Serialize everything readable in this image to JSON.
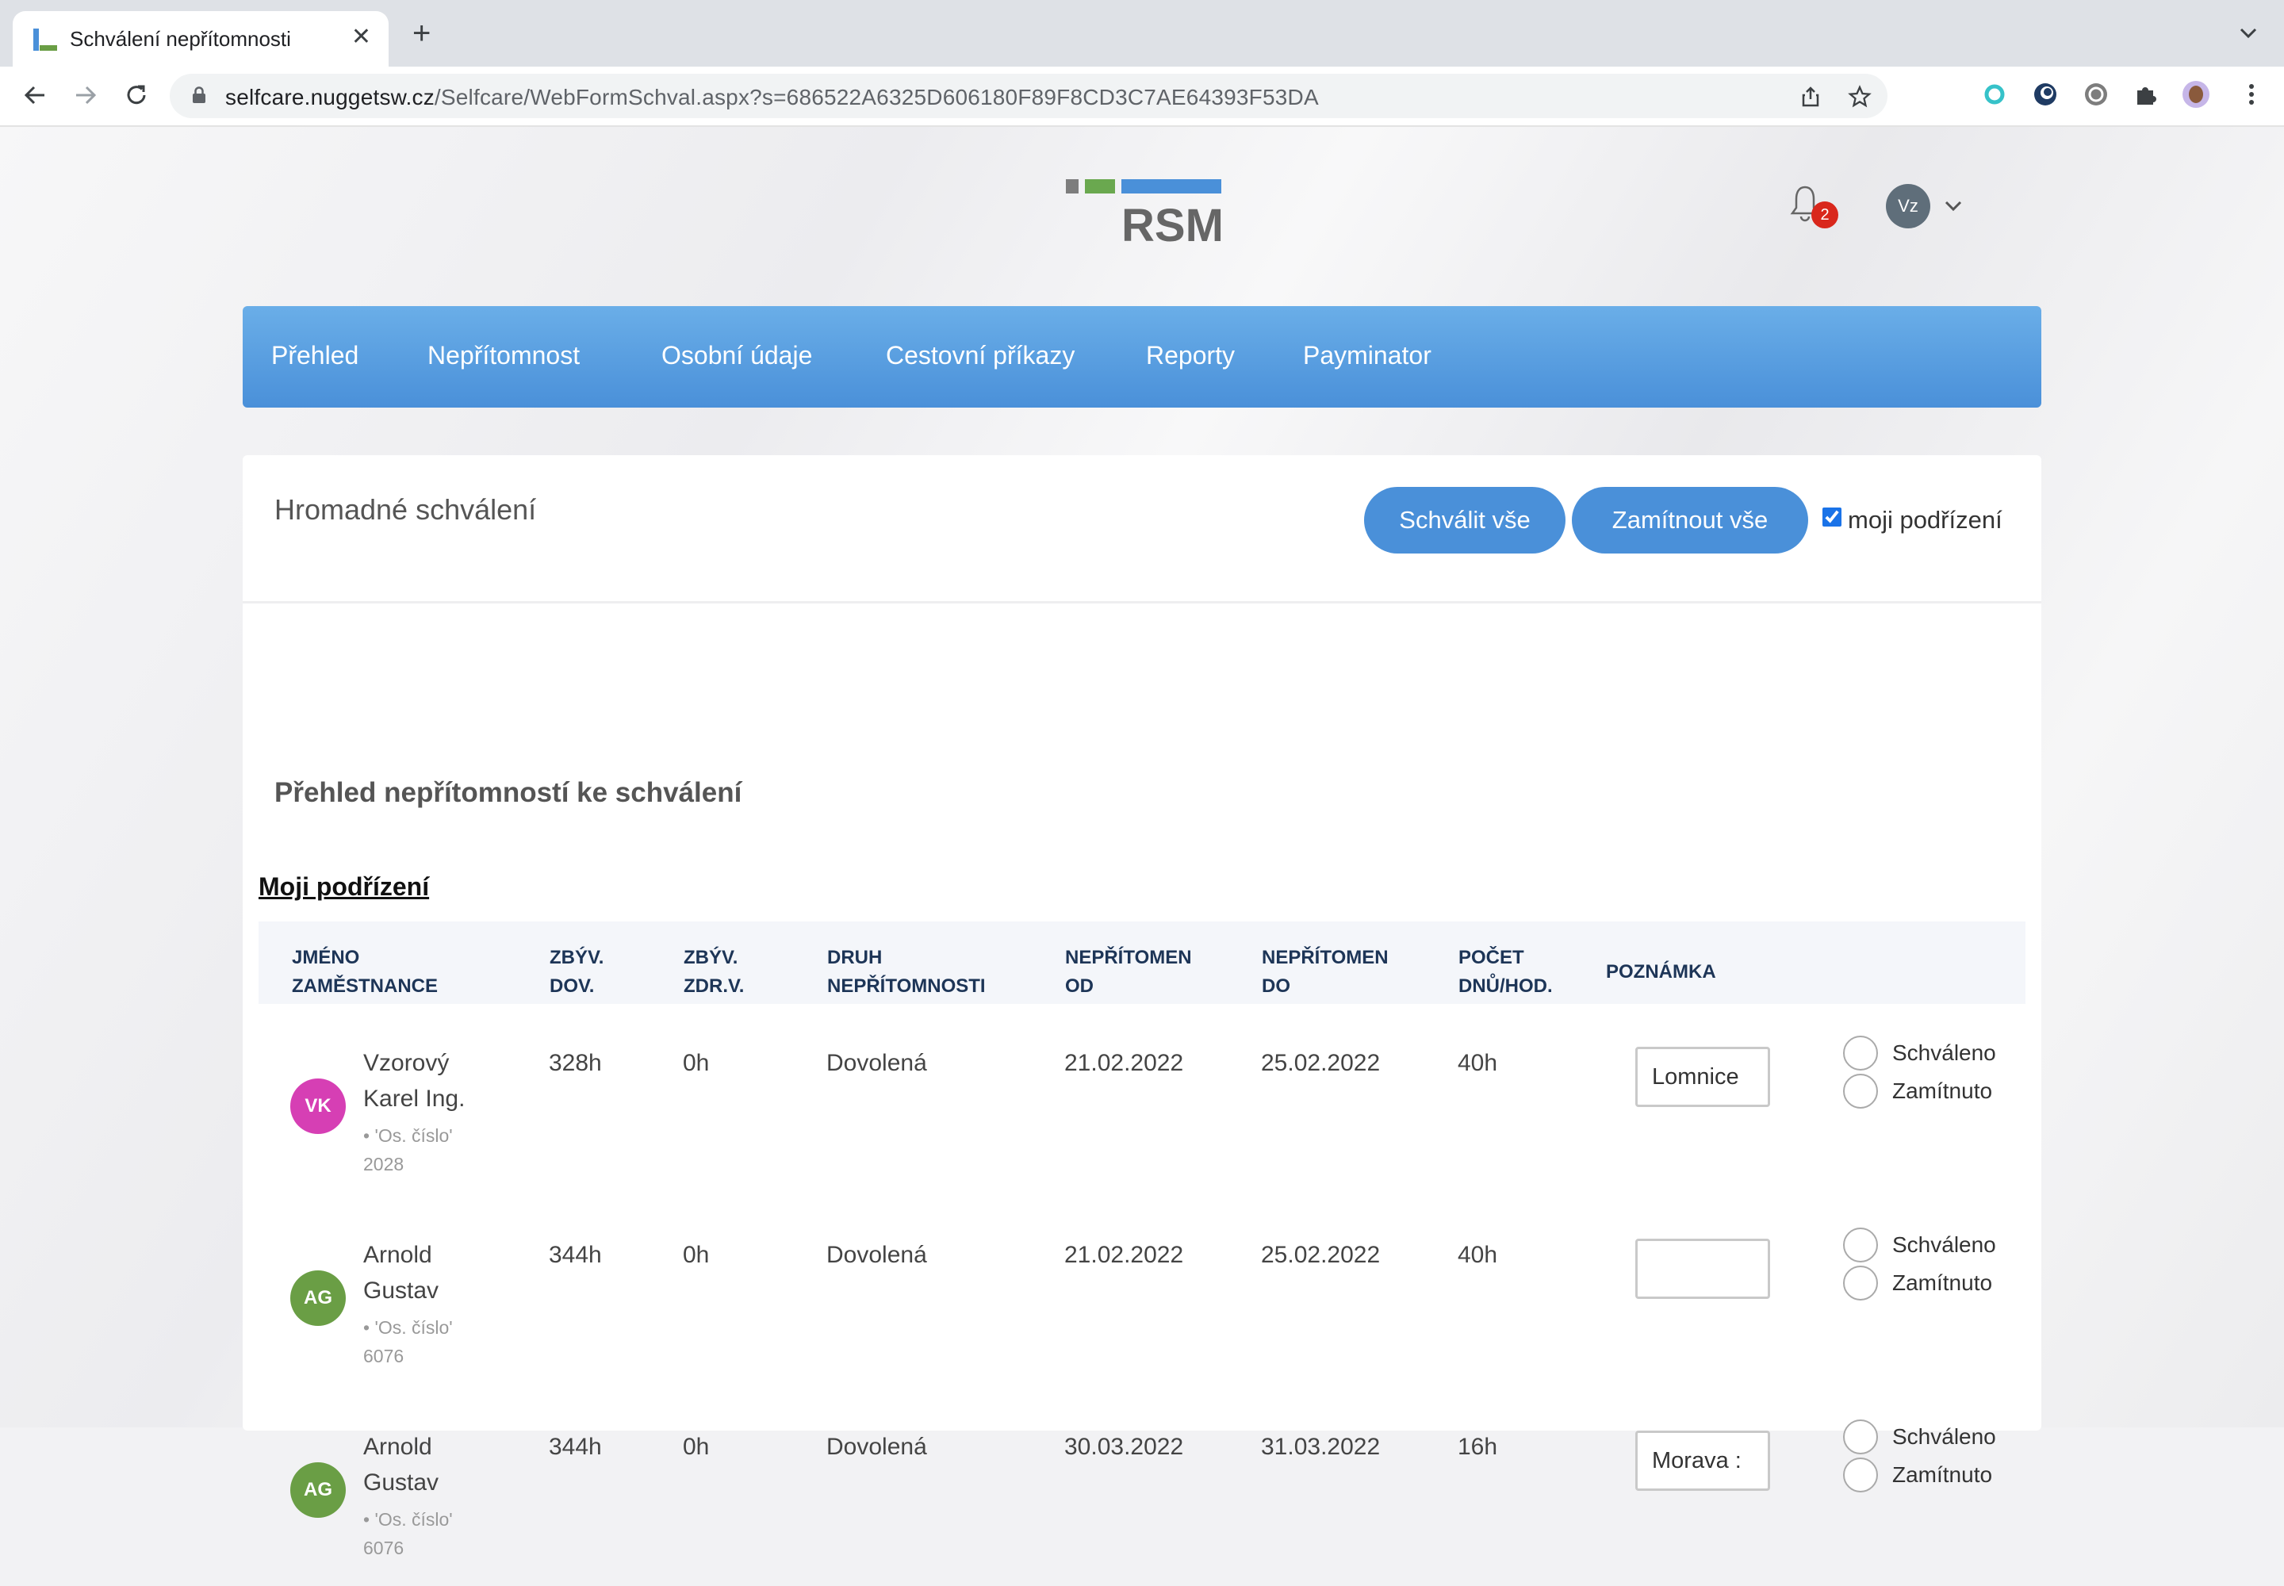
{
  "browser": {
    "tab_title": "Schválení nepřítomnosti",
    "url_host": "selfcare.nuggetsw.cz",
    "url_path": "/Selfcare/WebFormSchval.aspx?s=686522A6325D606180F89F8CD3C7AE64393F53DA"
  },
  "header": {
    "logo_text": "RSM",
    "notification_count": "2",
    "user_initials": "Vz"
  },
  "menu": [
    "Přehled",
    "Nepřítomnost",
    "Osobní údaje",
    "Cestovní příkazy",
    "Reporty",
    "Payminator"
  ],
  "card": {
    "title": "Hromadné schválení",
    "approve_all": "Schválit vše",
    "reject_all": "Zamítnout vše",
    "subordinates_label": "moji podřízení",
    "subordinates_checked": true,
    "subtitle": "Přehled nepřítomností ke schválení",
    "group_title": "Moji podřízení"
  },
  "table": {
    "headers": {
      "name": [
        "JMÉNO",
        "ZAMĚSTNANCE"
      ],
      "vac": [
        "ZBÝV.",
        "DOV."
      ],
      "sick": [
        "ZBÝV.",
        "ZDR.V."
      ],
      "type": [
        "DRUH",
        "NEPŘÍTOMNOSTI"
      ],
      "from": [
        "NEPŘÍTOMEN",
        "OD"
      ],
      "to": [
        "NEPŘÍTOMEN",
        "DO"
      ],
      "count": [
        "POČET",
        "DNŮ/HOD."
      ],
      "note": "POZNÁMKA"
    },
    "approve_label": "Schváleno",
    "reject_label": "Zamítnuto",
    "rows": [
      {
        "initials": "VK",
        "avatar_color": "#d63fb4",
        "name": [
          "Vzorový",
          "Karel Ing."
        ],
        "sub": [
          "• 'Os. číslo'",
          "2028"
        ],
        "vac": "328h",
        "sick": "0h",
        "type": "Dovolená",
        "from": "21.02.2022",
        "to": "25.02.2022",
        "count": "40h",
        "note": "Lomnice"
      },
      {
        "initials": "AG",
        "avatar_color": "#6a9e45",
        "name": [
          "Arnold",
          "Gustav"
        ],
        "sub": [
          "• 'Os. číslo'",
          "6076"
        ],
        "vac": "344h",
        "sick": "0h",
        "type": "Dovolená",
        "from": "21.02.2022",
        "to": "25.02.2022",
        "count": "40h",
        "note": ""
      },
      {
        "initials": "AG",
        "avatar_color": "#6a9e45",
        "name": [
          "Arnold",
          "Gustav"
        ],
        "sub": [
          "• 'Os. číslo'",
          "6076"
        ],
        "vac": "344h",
        "sick": "0h",
        "type": "Dovolená",
        "from": "30.03.2022",
        "to": "31.03.2022",
        "count": "16h",
        "note": "Morava :"
      }
    ]
  }
}
